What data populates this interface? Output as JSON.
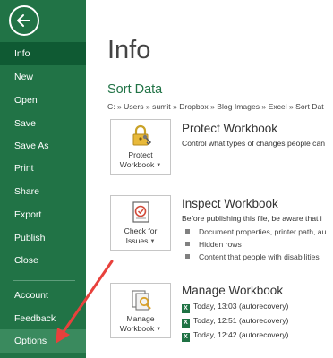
{
  "sidebar": {
    "items": [
      {
        "label": "Info",
        "state": "active"
      },
      {
        "label": "New"
      },
      {
        "label": "Open"
      },
      {
        "label": "Save"
      },
      {
        "label": "Save As"
      },
      {
        "label": "Print"
      },
      {
        "label": "Share"
      },
      {
        "label": "Export"
      },
      {
        "label": "Publish"
      },
      {
        "label": "Close"
      },
      {
        "label": "Account"
      },
      {
        "label": "Feedback"
      },
      {
        "label": "Options",
        "state": "hover"
      }
    ],
    "back_icon": "arrow-left-circle-icon"
  },
  "main": {
    "page_title": "Info",
    "doc_title": "Sort Data",
    "doc_path": "C: » Users » sumit » Dropbox » Blog Images » Excel » Sort Dat",
    "protect": {
      "button_line1": "Protect",
      "button_line2": "Workbook",
      "title": "Protect Workbook",
      "description": "Control what types of changes people can"
    },
    "inspect": {
      "button_line1": "Check for",
      "button_line2": "Issues",
      "title": "Inspect Workbook",
      "description": "Before publishing this file, be aware that i",
      "bullets": [
        "Document properties, printer path, au",
        "Hidden rows",
        "Content that people with disabilities"
      ]
    },
    "manage": {
      "button_line1": "Manage",
      "button_line2": "Workbook",
      "title": "Manage Workbook",
      "recoveries": [
        "Today, 13:03 (autorecovery)",
        "Today, 12:51 (autorecovery)",
        "Today, 12:42 (autorecovery)"
      ]
    }
  },
  "colors": {
    "sidebar": "#217346",
    "sidebar_active": "#0f5a33",
    "sidebar_hover": "#3a8a5e",
    "accent": "#217346",
    "annotation_arrow": "#e8413c"
  }
}
